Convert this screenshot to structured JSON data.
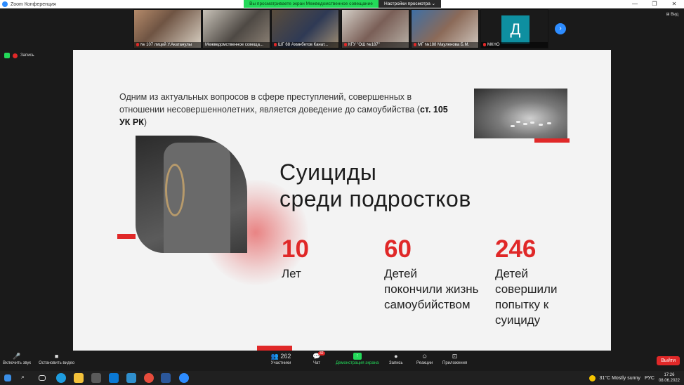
{
  "window": {
    "title": "Zoom Конференция",
    "minimize": "—",
    "maximize": "❐",
    "close": "✕"
  },
  "share_banner": {
    "text": "Вы просматриваете экран Межведомственное совещание",
    "options": "Настройки просмотра ⌄"
  },
  "participants": [
    {
      "name": "№ 107 лицей У.Акатанулы"
    },
    {
      "name": "Межведомственное совеща..."
    },
    {
      "name": "ШГ 68 Ахмнбетов Канат..."
    },
    {
      "name": "КГУ \"ОШ №187\""
    },
    {
      "name": "МГ №188 Мауленова Б.М."
    },
    {
      "name": "МКНО",
      "initial": "Д"
    }
  ],
  "recording": {
    "label": "Запись"
  },
  "view_button": "⊞ Вид",
  "slide": {
    "intro_text": "Одним из актуальных вопросов в сфере преступлений, совершенных в отношении несовершеннолетних, является доведение до самоубийства (",
    "intro_bold": "ст. 105 УК РК",
    "intro_end": ")",
    "heading_line1": "Суициды",
    "heading_line2": "среди подростков",
    "stats": [
      {
        "value": "10",
        "lines": [
          "Лет"
        ]
      },
      {
        "value": "60",
        "lines": [
          "Детей",
          "покончили жизнь",
          "самоубийством"
        ]
      },
      {
        "value": "246",
        "lines": [
          "Детей",
          "совершили",
          "попытку к",
          "суициду"
        ]
      }
    ]
  },
  "toolbar": {
    "mute": "Включить звук",
    "video": "Остановить видео",
    "participants": "Участники",
    "participants_count": "262",
    "chat": "Чат",
    "chat_badge": "32",
    "share": "Демонстрация экрана",
    "record": "Запись",
    "reactions": "Реакции",
    "apps": "Приложения",
    "exit": "Выйти"
  },
  "taskbar": {
    "weather": "31°C  Mostly sunny",
    "lang": "РУС",
    "time": "17:26",
    "date": "08.06.2022"
  },
  "colors": {
    "accent_red": "#e02828",
    "zoom_blue": "#2d8cff",
    "share_green": "#23d959"
  }
}
